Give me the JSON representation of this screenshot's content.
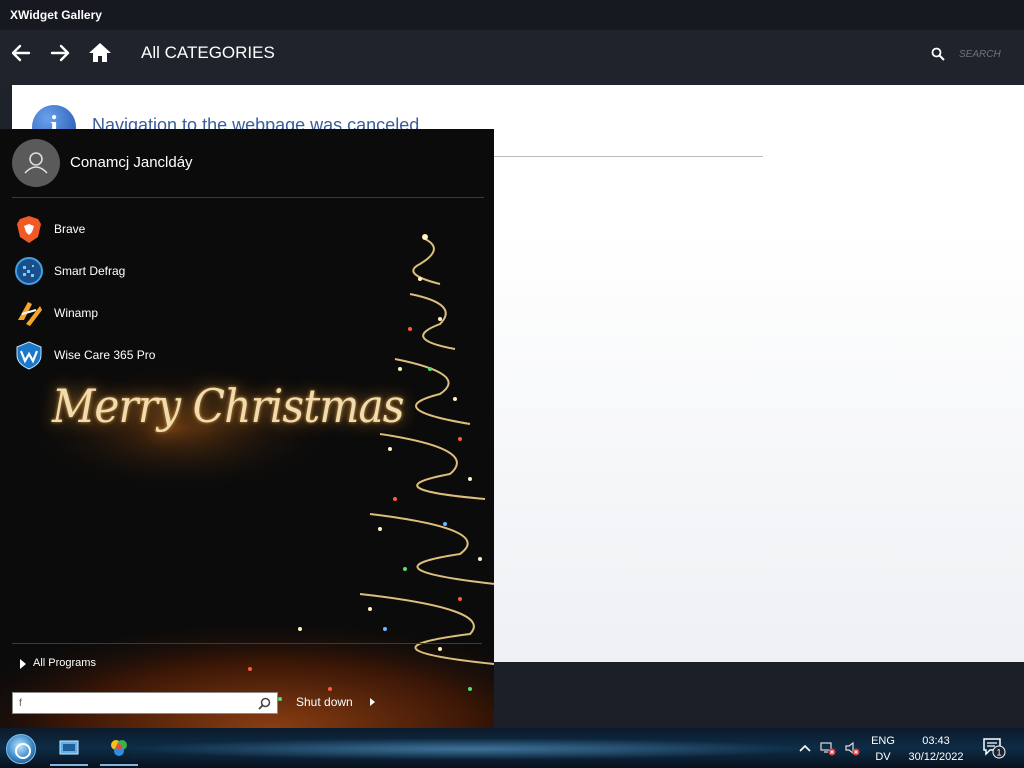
{
  "window": {
    "title": "XWidget Gallery",
    "category_title": "All CATEGORIES",
    "search_placeholder": "SEARCH",
    "message": "Navigation to the webpage was canceled"
  },
  "start_menu": {
    "user_name": "Conamcj Jancldáy",
    "apps": [
      {
        "label": "Brave",
        "icon": "brave-icon"
      },
      {
        "label": "Smart Defrag",
        "icon": "smart-defrag-icon"
      },
      {
        "label": "Winamp",
        "icon": "winamp-icon"
      },
      {
        "label": "Wise Care 365 Pro",
        "icon": "wise-care-icon"
      }
    ],
    "greeting": "Merry Christmas",
    "all_programs": "All Programs",
    "search_value": "f",
    "shutdown_label": "Shut down"
  },
  "taskbar": {
    "language": "ENG",
    "language_sub": "DV",
    "time": "03:43",
    "date": "30/12/2022",
    "notification_count": "1"
  },
  "colors": {
    "accent_blue": "#3a5d9c",
    "dark_bg": "#1e222b"
  }
}
